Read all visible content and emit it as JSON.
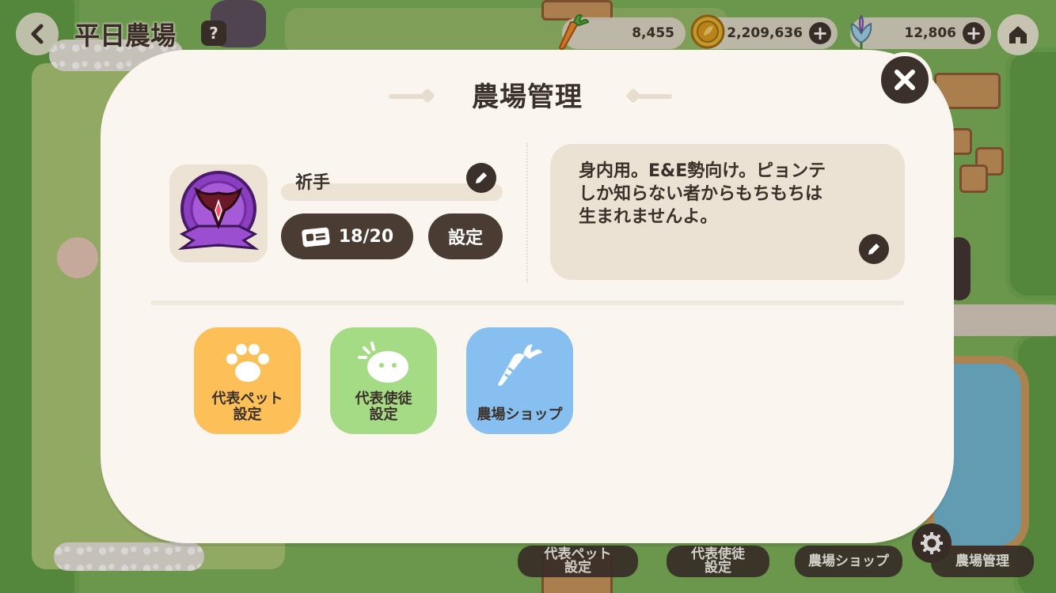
{
  "hud": {
    "farm_title": "平日農場",
    "help_label": "?",
    "resources": {
      "carrot": "8,455",
      "coin": "2,209,636",
      "flower": "12,806"
    }
  },
  "modal": {
    "title": "農場管理",
    "farm_name": "祈手",
    "member_count": "18/20",
    "settings_label": "設定",
    "description": "身内用。E&E勢向け。ピョンテ\nしか知らない者からもちもちは\n生まれませんよ。",
    "tiles": {
      "pet": "代表ペット\n設定",
      "disciple": "代表使徒\n設定",
      "shop": "農場ショップ"
    }
  },
  "bottom_bar": {
    "pet": "代表ペット\n設定",
    "disciple": "代表使徒\n設定",
    "shop": "農場ショップ",
    "manage": "農場管理"
  },
  "colors": {
    "accent_dark": "#3b302a",
    "panel": "#faf5ee",
    "pet_tile": "#fdbf57",
    "disciple_tile": "#a6db86",
    "shop_tile": "#86bff0"
  }
}
